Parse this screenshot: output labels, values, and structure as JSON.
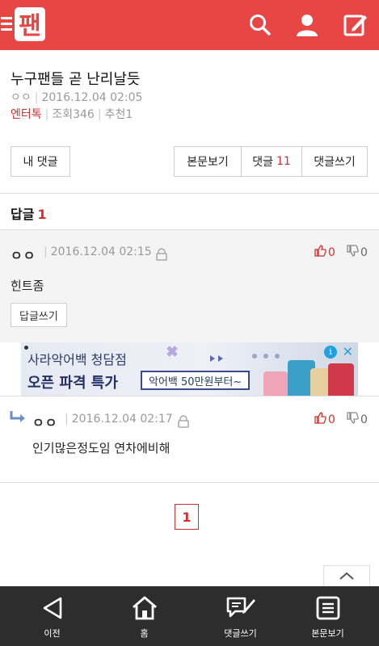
{
  "header": {
    "logo_text": "팬",
    "icons": [
      "menu-icon",
      "search-icon",
      "user-icon",
      "edit-icon"
    ],
    "accent": "#e84545"
  },
  "post": {
    "title": "누구팬들 곧 난리날듯",
    "author": "ㅇㅇ",
    "datetime": "2016.12.04 02:05",
    "category": "엔터톡",
    "views": "조회346",
    "recommend": "추천1"
  },
  "actions": {
    "my_comments": "내 댓글",
    "view_body": "본문보기",
    "comments_label": "댓글",
    "comments_count": "11",
    "write_comment": "댓글쓰기"
  },
  "replies": {
    "label": "답글",
    "count": "1",
    "items": [
      {
        "author": "ㅇㅇ",
        "datetime": "2016.12.04 02:15",
        "up": "0",
        "down": "0",
        "text": "힌트좀",
        "reply_button": "답글쓰기"
      },
      {
        "author": "ㅇㅇ",
        "datetime": "2016.12.04 02:17",
        "up": "0",
        "down": "0",
        "text": "인기많은정도임 연차에비해"
      }
    ]
  },
  "ad": {
    "line1": "사라악어백 청담점",
    "line2": "오픈 파격 특가",
    "pill": "악어백 50만원부터~",
    "info": "i",
    "close": "✕"
  },
  "pagination": {
    "current": "1"
  },
  "bottom_nav": [
    {
      "label": "이전",
      "icon": "back-icon"
    },
    {
      "label": "홈",
      "icon": "home-icon"
    },
    {
      "label": "댓글쓰기",
      "icon": "comment-write-icon"
    },
    {
      "label": "본문보기",
      "icon": "document-icon"
    }
  ]
}
